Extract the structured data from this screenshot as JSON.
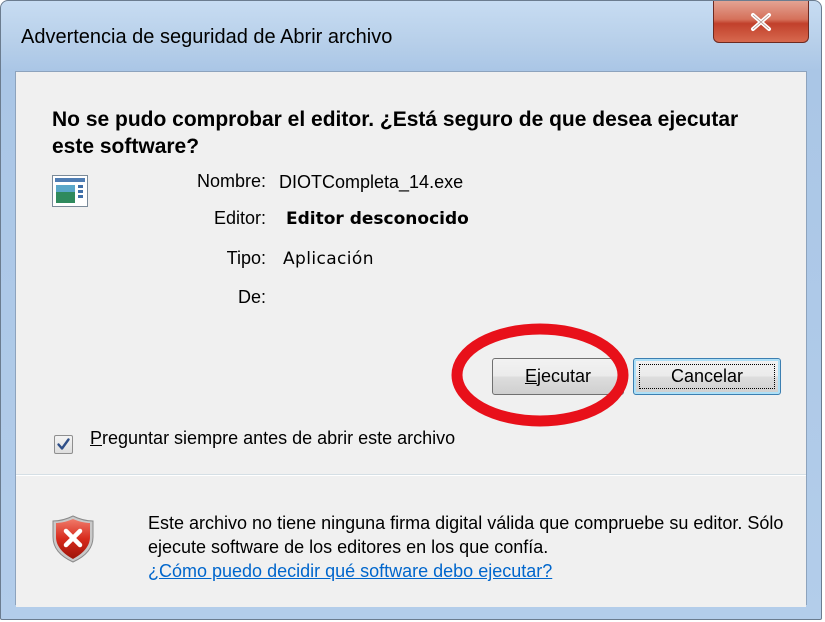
{
  "window": {
    "title": "Advertencia de seguridad de Abrir archivo",
    "close_label": "X"
  },
  "dialog": {
    "heading": "No se pudo comprobar el editor. ¿Está seguro de que desea ejecutar este software?",
    "fields": {
      "name_label": "Nombre:",
      "name_value": "DIOTCompleta_14.exe",
      "publisher_label": "Editor:",
      "publisher_value": "Editor desconocido",
      "type_label": "Tipo:",
      "type_value": "Aplicación",
      "from_label": "De:",
      "from_value": ""
    },
    "buttons": {
      "run_mnemonic": "E",
      "run_rest": "jecutar",
      "cancel_label": "Cancelar"
    },
    "checkbox": {
      "checked": true,
      "label_mnemonic": "P",
      "label_rest": "reguntar siempre antes de abrir este archivo"
    },
    "footer": {
      "warning_text": "Este archivo no tiene ninguna firma digital válida que compruebe su editor. Sólo ejecute software de los editores en los que confía.",
      "help_link": "¿Cómo puedo decidir qué software debo ejecutar?"
    }
  },
  "colors": {
    "highlight_ellipse": "#e8101a",
    "link": "#0066cc",
    "close_button": "#c1402b"
  },
  "icons": {
    "app": "application-window-icon",
    "warning": "red-shield-x-icon",
    "close": "close-x-icon"
  }
}
